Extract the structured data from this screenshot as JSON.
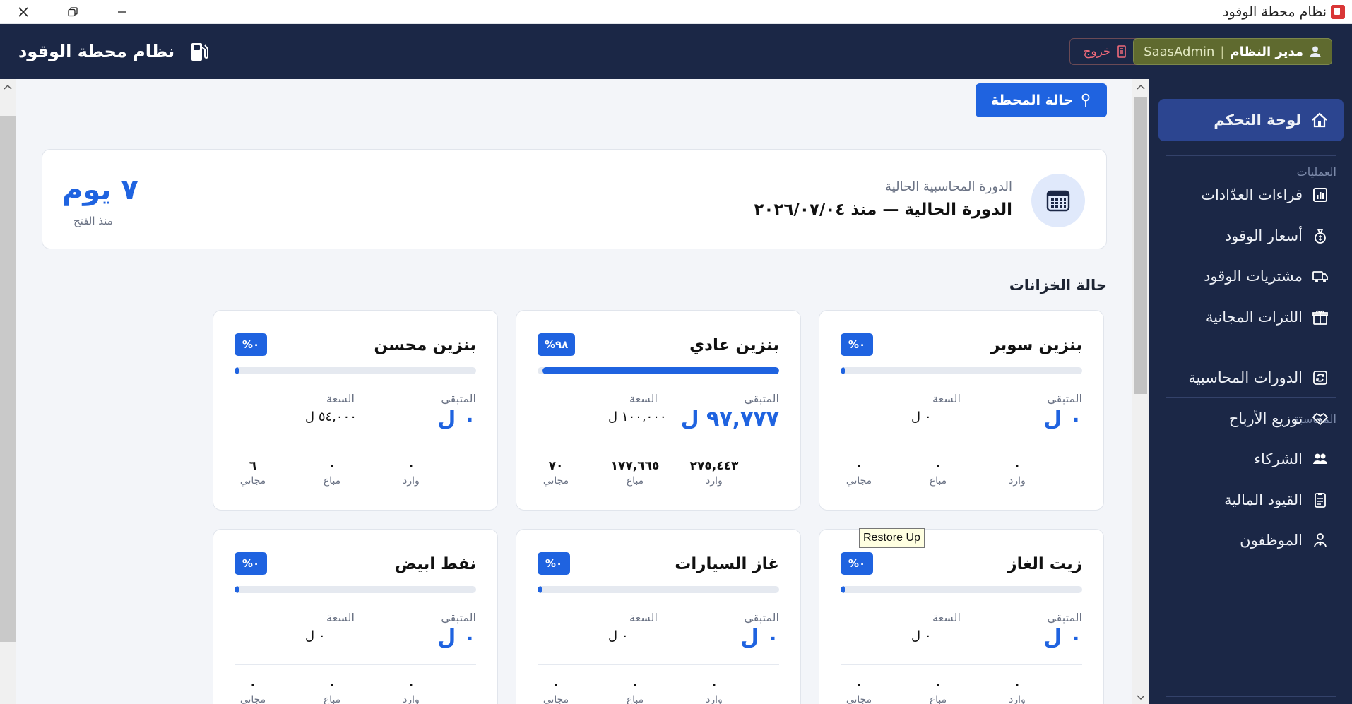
{
  "window": {
    "title": "نظام محطة الوقود"
  },
  "header": {
    "brand": "نظام محطة الوقود",
    "user_role": "مدير النظام",
    "user_sep": "|",
    "user_name": "SaasAdmin",
    "logout": "خروج"
  },
  "main": {
    "station_button": "حالة المحطة",
    "cycle": {
      "label": "الدورة المحاسبية الحالية",
      "value": "الدورة الحالية — منذ ٢٠٢٦/٠٧/٠٤",
      "days": "٧ يوم",
      "days_sub": "منذ الفتح"
    },
    "tanks_title": "حالة الخزانات",
    "labels": {
      "remaining": "المتبقي",
      "capacity": "السعة",
      "incoming": "وارد",
      "sold": "مباع",
      "free": "مجاني"
    },
    "tanks": [
      {
        "name": "بنزين سوبر",
        "percent": "%٠",
        "fill": 0,
        "remaining": "٠ ل",
        "capacity": "٠ ل",
        "incoming": "٠",
        "sold": "٠",
        "free": "٠"
      },
      {
        "name": "بنزين عادي",
        "percent": "%٩٨",
        "fill": 0.98,
        "remaining": "٩٧,٧٧٧ ل",
        "capacity": "١٠٠,٠٠٠ ل",
        "incoming": "٢٧٥,٤٤٣",
        "sold": "١٧٧,٦٦٥",
        "free": "٧٠"
      },
      {
        "name": "بنزين محسن",
        "percent": "%٠",
        "fill": 0,
        "remaining": "٠ ل",
        "capacity": "٥٤,٠٠٠ ل",
        "incoming": "٠",
        "sold": "٠",
        "free": "٦"
      },
      {
        "name": "زيت الغاز",
        "percent": "%٠",
        "fill": 0,
        "remaining": "٠ ل",
        "capacity": "٠ ل",
        "incoming": "٠",
        "sold": "٠",
        "free": "٠"
      },
      {
        "name": "غاز السيارات",
        "percent": "%٠",
        "fill": 0,
        "remaining": "٠ ل",
        "capacity": "٠ ل",
        "incoming": "٠",
        "sold": "٠",
        "free": "٠"
      },
      {
        "name": "نفط ابيض",
        "percent": "%٠",
        "fill": 0,
        "remaining": "٠ ل",
        "capacity": "٠ ل",
        "incoming": "٠",
        "sold": "٠",
        "free": "٠"
      }
    ],
    "tooltip": "Restore Up"
  },
  "sidebar": {
    "dashboard": "لوحة التحكم",
    "section_ops": "العمليات",
    "section_accounting": "المحاسبة",
    "ops_items": [
      {
        "label": "قراءات العدّادات",
        "icon": "chart-icon"
      },
      {
        "label": "أسعار الوقود",
        "icon": "money-bag-icon"
      },
      {
        "label": "مشتريات الوقود",
        "icon": "truck-icon"
      },
      {
        "label": "اللترات المجانية",
        "icon": "gift-icon"
      }
    ],
    "acc_items": [
      {
        "label": "الدورات المحاسبية",
        "icon": "cycle-icon"
      },
      {
        "label": "توزيع الأرباح",
        "icon": "handshake-icon"
      },
      {
        "label": "الشركاء",
        "icon": "people-icon"
      },
      {
        "label": "القيود المالية",
        "icon": "journal-icon"
      },
      {
        "label": "الموظفون",
        "icon": "employee-icon"
      }
    ]
  }
}
